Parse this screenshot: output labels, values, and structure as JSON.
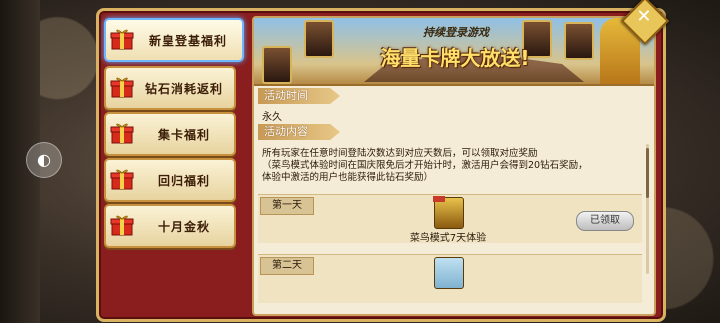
{
  "sidebar": {
    "items": [
      {
        "label": "新皇登基福利",
        "icon": "gift-icon",
        "active": true
      },
      {
        "label": "钻石消耗返利",
        "icon": "gift-icon",
        "active": false
      },
      {
        "label": "集卡福利",
        "icon": "gift-icon",
        "active": false
      },
      {
        "label": "回归福利",
        "icon": "gift-icon",
        "active": false
      },
      {
        "label": "十月金秋",
        "icon": "gift-icon",
        "active": false
      }
    ]
  },
  "banner": {
    "subtitle": "持续登录游戏",
    "title": "海量卡牌大放送!"
  },
  "event": {
    "time_tag": "活动时间",
    "time_value": "永久",
    "content_tag": "活动内容",
    "description": "所有玩家在任意时间登陆次数达到对应天数后，可以领取对应奖励\n（菜鸟模式体验时间在国庆限免后才开始计时，激活用户会得到20钻石奖励，\n体验中激活的用户也能获得此钻石奖励）",
    "days": [
      {
        "day": "第一天",
        "reward": "菜鸟模式7天体验",
        "button": "已领取",
        "icon": "rookie-mode-card-icon"
      },
      {
        "day": "第二天",
        "reward": "",
        "button": "",
        "icon": "reward-card-icon"
      }
    ]
  },
  "colors": {
    "frame": "#8a1d1d",
    "gold": "#d8b260",
    "parchment": "#f4ecd6"
  }
}
